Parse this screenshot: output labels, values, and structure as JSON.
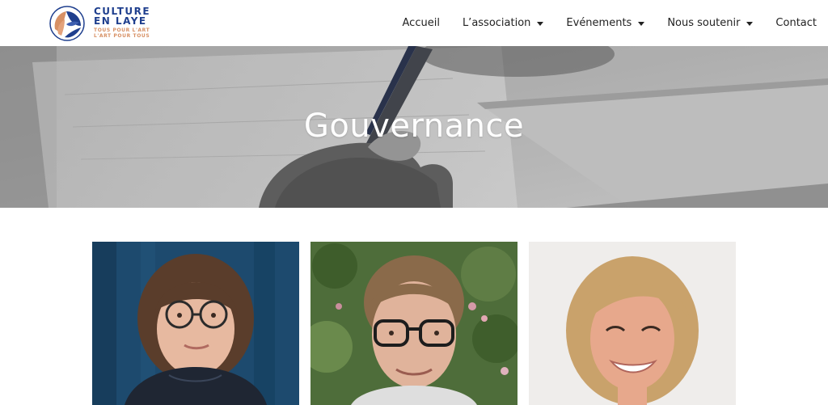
{
  "brand": {
    "name_line1": "CULTURE",
    "name_line2": "EN LAYE",
    "tagline_line1": "TOUS POUR L'ART",
    "tagline_line2": "L'ART POUR TOUS",
    "primary_color": "#1f3f8e",
    "accent_color": "#d79064"
  },
  "nav": {
    "items": [
      {
        "label": "Accueil",
        "has_dropdown": false
      },
      {
        "label": "L’association",
        "has_dropdown": true
      },
      {
        "label": "Evénements",
        "has_dropdown": true
      },
      {
        "label": "Nous soutenir",
        "has_dropdown": true
      },
      {
        "label": "Contact",
        "has_dropdown": false
      }
    ]
  },
  "hero": {
    "title": "Gouvernance",
    "image": "hand-writing-with-pen-photo"
  },
  "team": {
    "members": [
      {
        "photo": "woman-with-glasses-blue-curtain-photo"
      },
      {
        "photo": "man-with-glasses-garden-photo"
      },
      {
        "photo": "blonde-woman-smiling-photo"
      }
    ]
  }
}
